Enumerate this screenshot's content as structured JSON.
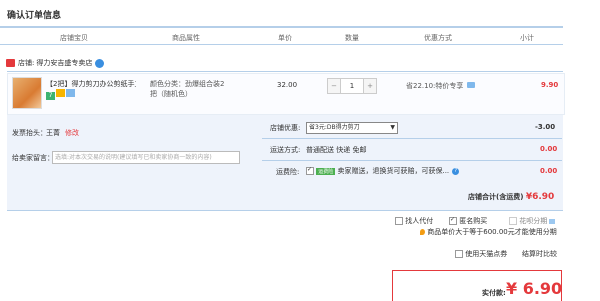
{
  "title": "确认订单信息",
  "columns": [
    "店铺宝贝",
    "商品属性",
    "单价",
    "数量",
    "优惠方式",
    "小计"
  ],
  "store": {
    "label": "店铺:",
    "name": "得力安吉盛专卖店"
  },
  "item": {
    "name": "【2把】得力剪刀办公剪纸手工...",
    "attr": "颜色分类：劲爆组合装2把（随机色）",
    "price": "32.00",
    "qty_minus": "−",
    "qty": "1",
    "qty_plus": "+",
    "promo": "省22.10:特价专享",
    "subtotal": "9.90",
    "badge_label": "7"
  },
  "order": {
    "invoice_label": "发票抬头：",
    "invoice_value": "王菁",
    "invoice_edit": "修改",
    "memo_label": "给卖家留言：",
    "memo_placeholder": "选填:对本次交易的说明(建议填写已和卖家协商一致的内容)",
    "coupon_label": "店铺优惠:",
    "coupon_value": "省3元:DB得力剪刀",
    "coupon_arrow": "▼",
    "coupon_amount": "-3.00",
    "ship_label": "运送方式:",
    "ship_value": "普通配送 快递 免邮",
    "ship_amount": "0.00",
    "insure_label": "运费险:",
    "insure_badge": "运费险",
    "insure_text": "卖家赠送，退换货可获赔，可获保...",
    "insure_amount": "0.00",
    "store_total_label": "店铺合计(含运费)",
    "store_total_amount": "¥6.90"
  },
  "options": {
    "proxy": "找人代付",
    "anon": "匿名购买",
    "installment": "花呗分期",
    "tip": "商品单价大于等于600.00元才能使用分期",
    "tmall_points": "使用天猫点券",
    "settle": "结算时比较"
  },
  "final": {
    "label": "实付款:",
    "amount": "¥ 6.90"
  }
}
